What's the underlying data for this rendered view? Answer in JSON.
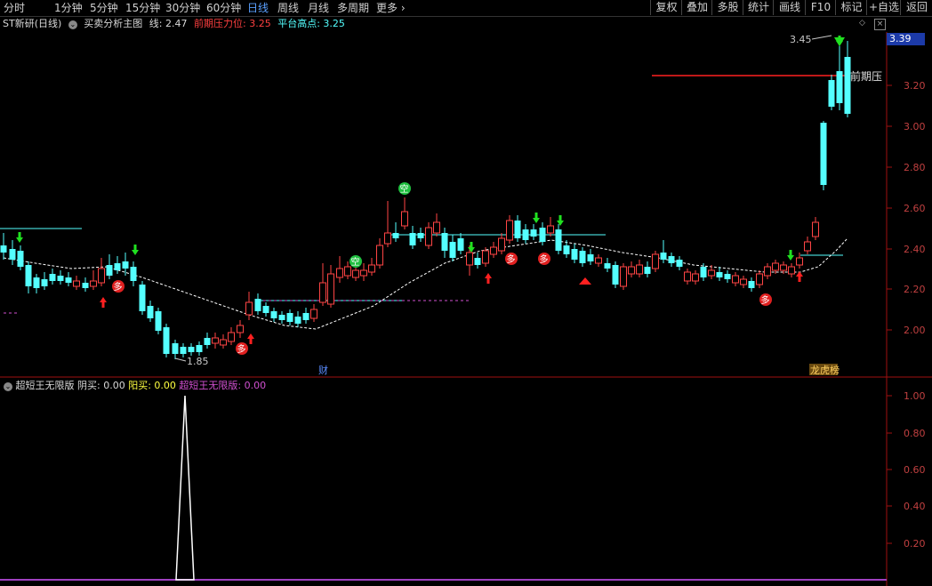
{
  "toolbar": {
    "periods": [
      "分时",
      "1分钟",
      "5分钟",
      "15分钟",
      "30分钟",
      "60分钟",
      "日线",
      "周线",
      "月线",
      "多周期",
      "更多"
    ],
    "active_period": "日线",
    "right_buttons": [
      "复权",
      "叠加",
      "多股",
      "统计",
      "画线",
      "F10",
      "标记",
      "+自选",
      "返回"
    ]
  },
  "main_info": {
    "stock": "ST新研(日线)",
    "indicator": "买卖分析主图",
    "line_label": "线: 2.47",
    "pressure_label": "前期压力位: 3.25",
    "platform_label": "平台高点: 3.25"
  },
  "price_tag": "3.39",
  "axis": {
    "main_ticks": [
      "3.20",
      "3.00",
      "2.80",
      "2.60",
      "2.40",
      "2.20",
      "2.00"
    ],
    "sub_ticks": [
      "1.00",
      "0.80",
      "0.60",
      "0.40",
      "0.20"
    ]
  },
  "annotations": {
    "high": "3.45",
    "low": "1.85",
    "pressure_text": "前期压",
    "cai": "财",
    "lhb": "龙虎榜",
    "kong": "空",
    "duo": "多"
  },
  "sub_info": {
    "name": "超短王无限版",
    "yinmai": "阴买: 0.00",
    "yangmai": "阳买: 0.00",
    "value": "超短王无限版: 0.00"
  },
  "colors": {
    "up": "#ff4545",
    "down": "#54ffff",
    "ma": "#ffffff",
    "pressure": "#ff2020",
    "platform": "#54ffff",
    "axis": "#a01010"
  }
}
